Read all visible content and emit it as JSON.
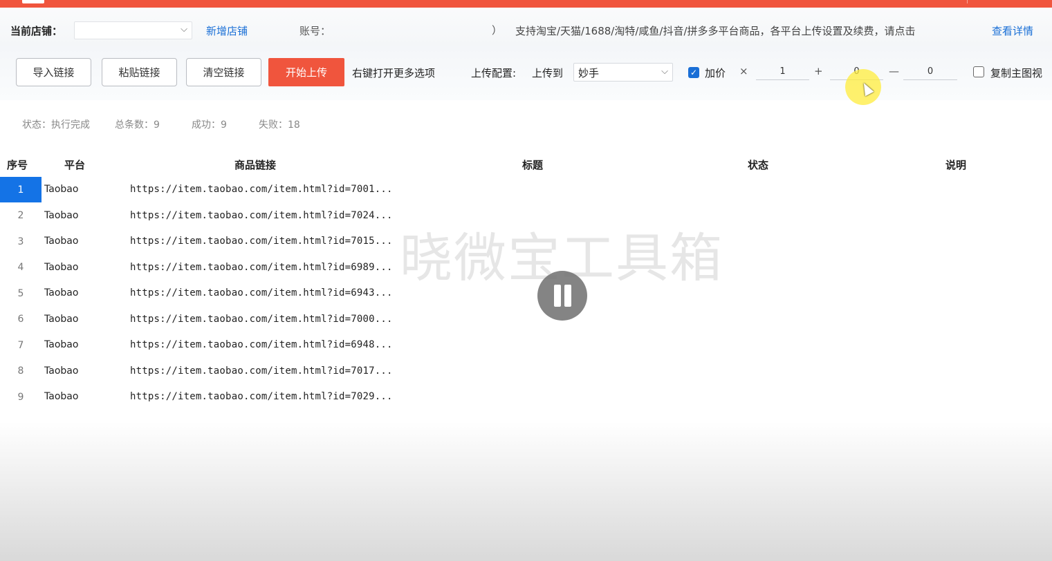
{
  "header": {
    "store_label": "当前店铺：",
    "store_value": "",
    "add_store": "新增店铺",
    "account_label": "账号：",
    "account_value": "",
    "account_paren": "）",
    "support_text": "支持淘宝/天猫/1688/淘特/咸鱼/抖音/拼多多平台商品，各平台上传设置及续费，请点击",
    "detail_link": "查看详情"
  },
  "toolbar": {
    "import_label": "导入链接",
    "paste_label": "粘贴链接",
    "clear_label": "清空链接",
    "start_label": "开始上传",
    "rightclick_hint": "右键打开更多选项",
    "upload_config_label": "上传配置:",
    "upload_to_label": "上传到",
    "upload_target": "妙手",
    "price_checked": true,
    "price_label": "加价",
    "op_multiply": "×",
    "multiplier": "1",
    "op_plus": "+",
    "addend": "0",
    "op_minus": "—",
    "subtrahend": "0",
    "copy_checked": false,
    "copy_label": "复制主图视"
  },
  "status": {
    "state": "状态：执行完成",
    "total": "总条数：9",
    "success": "成功：9",
    "fail": "失败：18"
  },
  "table": {
    "columns": [
      "序号",
      "平台",
      "商品链接",
      "标题",
      "状态",
      "说明"
    ],
    "rows": [
      {
        "seq": "1",
        "platform": "Taobao",
        "url": "https://item.taobao.com/item.html?id=7001..."
      },
      {
        "seq": "2",
        "platform": "Taobao",
        "url": "https://item.taobao.com/item.html?id=7024..."
      },
      {
        "seq": "3",
        "platform": "Taobao",
        "url": "https://item.taobao.com/item.html?id=7015..."
      },
      {
        "seq": "4",
        "platform": "Taobao",
        "url": "https://item.taobao.com/item.html?id=6989..."
      },
      {
        "seq": "5",
        "platform": "Taobao",
        "url": "https://item.taobao.com/item.html?id=6943..."
      },
      {
        "seq": "6",
        "platform": "Taobao",
        "url": "https://item.taobao.com/item.html?id=7000..."
      },
      {
        "seq": "7",
        "platform": "Taobao",
        "url": "https://item.taobao.com/item.html?id=6948..."
      },
      {
        "seq": "8",
        "platform": "Taobao",
        "url": "https://item.taobao.com/item.html?id=7017..."
      },
      {
        "seq": "9",
        "platform": "Taobao",
        "url": "https://item.taobao.com/item.html?id=7029..."
      }
    ]
  },
  "overlay": {
    "watermark": "晓微宝工具箱",
    "pause_icon": "pause-icon"
  },
  "colors": {
    "accent_red": "#f0553d",
    "link_blue": "#1a6fd6",
    "selection_blue": "#1473e6"
  }
}
